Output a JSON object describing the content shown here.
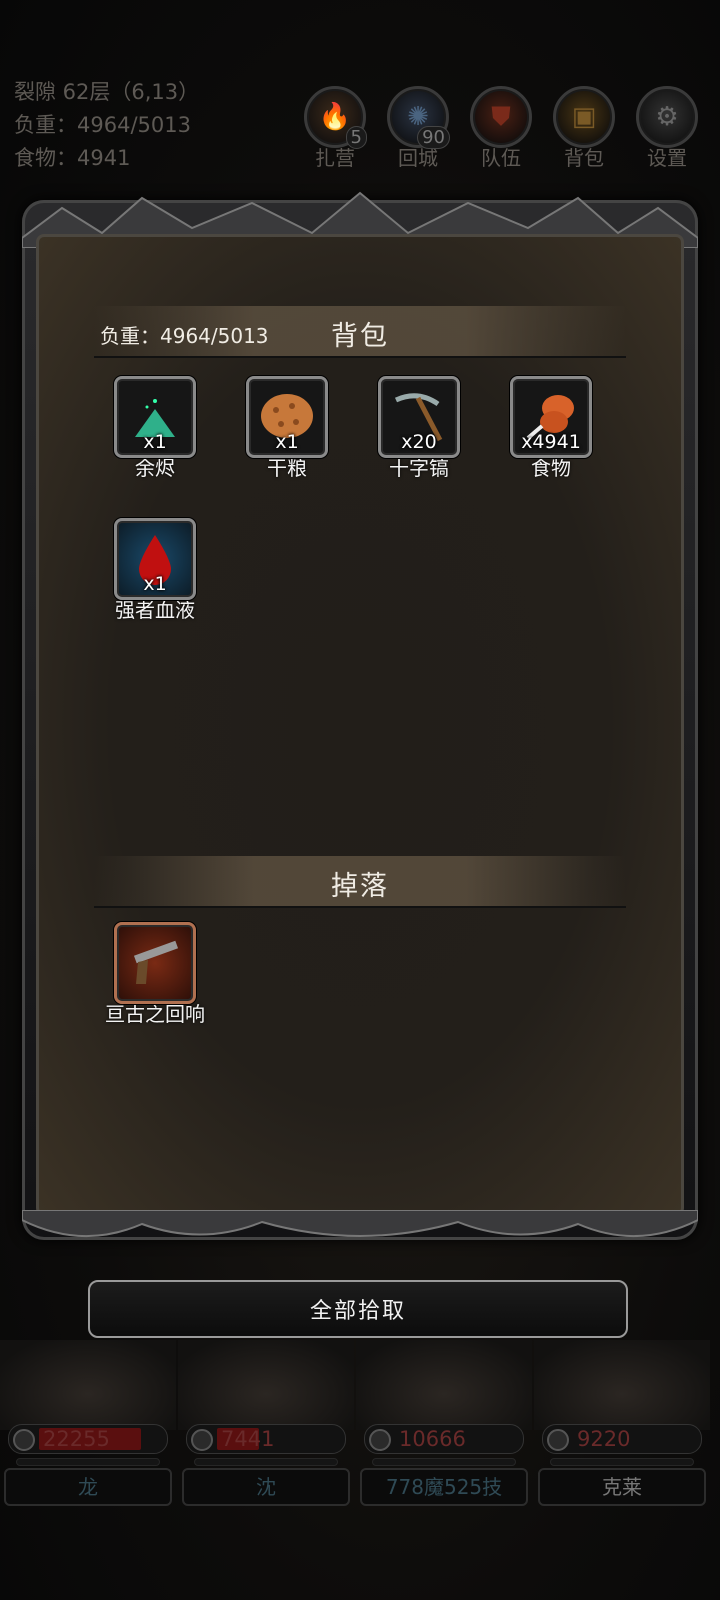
{
  "status": {
    "location": "裂隙 62层（6,13）",
    "weight": "负重：4964/5013",
    "food": "食物：4941"
  },
  "top_buttons": [
    {
      "label": "扎营",
      "count": "5",
      "icon": "campfire-icon"
    },
    {
      "label": "回城",
      "count": "90",
      "icon": "portal-icon"
    },
    {
      "label": "队伍",
      "count": "",
      "icon": "team-icon"
    },
    {
      "label": "背包",
      "count": "",
      "icon": "chest-icon"
    },
    {
      "label": "设置",
      "count": "",
      "icon": "gear-icon"
    }
  ],
  "backpack": {
    "title": "背包",
    "weight": "负重：4964/5013",
    "items": [
      {
        "name": "余烬",
        "qty": "x1",
        "icon": "ember-icon"
      },
      {
        "name": "干粮",
        "qty": "x1",
        "icon": "biscuit-icon"
      },
      {
        "name": "十字镐",
        "qty": "x20",
        "icon": "pickaxe-icon"
      },
      {
        "name": "食物",
        "qty": "x4941",
        "icon": "meat-icon"
      },
      {
        "name": "强者血液",
        "qty": "x1",
        "icon": "blood-drop-icon"
      }
    ]
  },
  "drops": {
    "title": "掉落",
    "items": [
      {
        "name": "亘古之回响",
        "qty": "",
        "icon": "pistol-icon"
      }
    ]
  },
  "pick_all_label": "全部拾取",
  "party": [
    {
      "hp": "22255",
      "hp_fraction": 0.85,
      "name": "龙"
    },
    {
      "hp": "7441",
      "hp_fraction": 0.35,
      "name": "沈"
    },
    {
      "hp": "10666",
      "hp_fraction": 0.0,
      "name": "778魔525技"
    },
    {
      "hp": "9220",
      "hp_fraction": 0.0,
      "name": "克莱"
    }
  ]
}
